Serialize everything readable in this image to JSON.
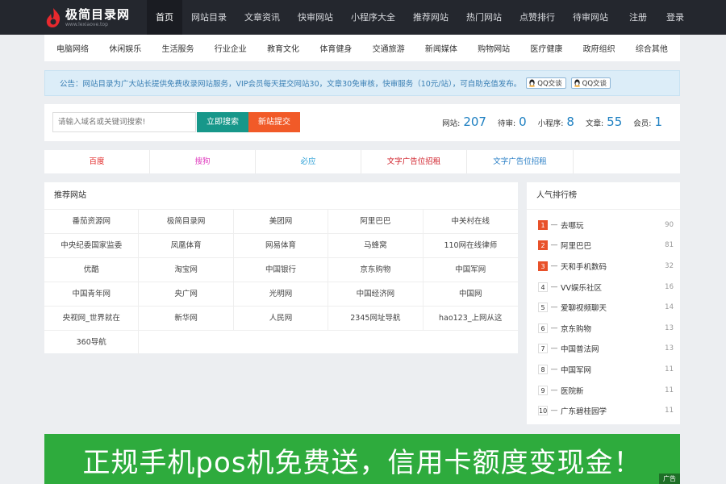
{
  "header": {
    "logo_title": "极简目录网",
    "logo_sub": "www.lexiaove.top",
    "nav": [
      "首页",
      "网站目录",
      "文章资讯",
      "快审网站",
      "小程序大全",
      "推荐网站",
      "热门网站",
      "点赞排行",
      "待审网站"
    ],
    "active_index": 0,
    "register": "注册",
    "login": "登录"
  },
  "categories": [
    "电脑网络",
    "休闲娱乐",
    "生活服务",
    "行业企业",
    "教育文化",
    "体育健身",
    "交通旅游",
    "新闻媒体",
    "购物网站",
    "医疗健康",
    "政府组织",
    "综合其他"
  ],
  "notice": {
    "text": "公告：网站目录为广大站长提供免费收录网站服务，VIP会员每天提交网站30，文章30免审核，快审服务（10元/站），可自助充值发布。",
    "qq1": "QQ交谈",
    "qq2": "QQ交谈"
  },
  "search": {
    "placeholder": "请输入域名或关键词搜索!",
    "search_button": "立即搜索",
    "submit_button": "新站提交"
  },
  "stats": [
    {
      "label": "网站:",
      "value": "207"
    },
    {
      "label": "待审:",
      "value": "0"
    },
    {
      "label": "小程序:",
      "value": "8"
    },
    {
      "label": "文章:",
      "value": "55"
    },
    {
      "label": "会员:",
      "value": "1"
    }
  ],
  "text_ads": [
    {
      "label": "百度",
      "color": "#e02020"
    },
    {
      "label": "搜狗",
      "color": "#e040c0"
    },
    {
      "label": "必应",
      "color": "#2a9fd6"
    },
    {
      "label": "文字广告位招租",
      "color": "#d0202a"
    },
    {
      "label": "文字广告位招租",
      "color": "#2a7fc6"
    },
    {
      "label": "",
      "color": "#333333"
    }
  ],
  "recommend": {
    "title": "推荐网站",
    "rows": [
      [
        "番茄资源网",
        "极简目录网",
        "美团网",
        "阿里巴巴",
        "中关村在线"
      ],
      [
        "中央纪委国家监委",
        "凤凰体育",
        "网易体育",
        "马蜂窝",
        "110网在线律师"
      ],
      [
        "优酷",
        "淘宝网",
        "中国银行",
        "京东购物",
        "中国军网"
      ],
      [
        "中国青年网",
        "央广网",
        "光明网",
        "中国经济网",
        "中国网"
      ],
      [
        "央视网_世界就在",
        "新华网",
        "人民网",
        "2345网址导航",
        "hao123_上网从这"
      ],
      [
        "360导航",
        "",
        "",
        "",
        ""
      ]
    ]
  },
  "ranking": {
    "title": "人气排行榜",
    "items": [
      {
        "rank": "1",
        "name": "去哪玩",
        "count": "90"
      },
      {
        "rank": "2",
        "name": "阿里巴巴",
        "count": "81"
      },
      {
        "rank": "3",
        "name": "天和手机数码",
        "count": "32"
      },
      {
        "rank": "4",
        "name": "VV娱乐社区",
        "count": "16"
      },
      {
        "rank": "5",
        "name": "爱聊视频聊天",
        "count": "14"
      },
      {
        "rank": "6",
        "name": "京东购物",
        "count": "13"
      },
      {
        "rank": "7",
        "name": "中国普法网",
        "count": "13"
      },
      {
        "rank": "8",
        "name": "中国军网",
        "count": "11"
      },
      {
        "rank": "9",
        "name": "医院新",
        "count": "11"
      },
      {
        "rank": "10",
        "name": "广东碧桂园学",
        "count": "11"
      }
    ]
  },
  "banner": {
    "text": "正规手机pos机免费送，信用卡额度变现金！",
    "tag": "广告",
    "bg_color": "#2eab3d"
  }
}
